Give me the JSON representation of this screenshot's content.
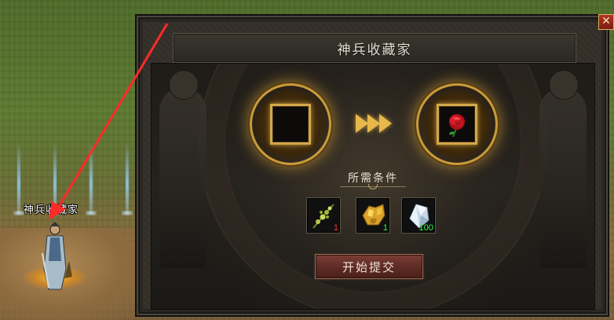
{
  "npc": {
    "name": "神兵收藏家"
  },
  "dialog": {
    "title": "神兵收藏家",
    "close_label": "✕",
    "input_slot": {
      "item": ""
    },
    "output_slot": {
      "item": "rose-icon"
    },
    "requirements_label": "所需条件",
    "requirements": [
      {
        "icon": "herb-icon",
        "count": "1",
        "count_color": "#ff3a2a"
      },
      {
        "icon": "gold-ore-icon",
        "count": "1",
        "count_color": "#33ff44"
      },
      {
        "icon": "crystal-icon",
        "count": "100",
        "count_color": "#33ff44"
      }
    ],
    "submit_label": "开始提交"
  },
  "colors": {
    "accent_gold": "#d2a84c",
    "button_red": "#5c2b24",
    "arrow_red": "#ff2a2a"
  }
}
